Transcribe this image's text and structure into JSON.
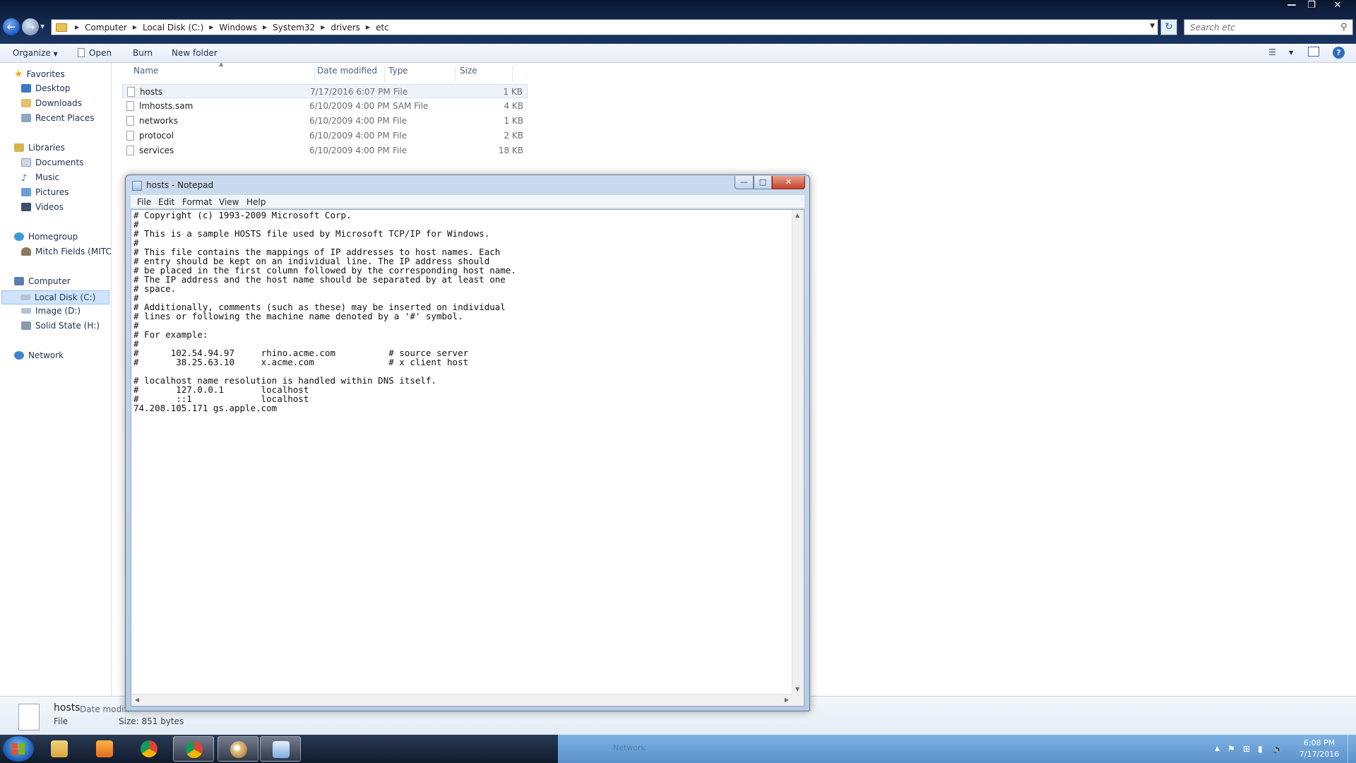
{
  "explorer": {
    "breadcrumb": [
      "Computer",
      "Local Disk (C:)",
      "Windows",
      "System32",
      "drivers",
      "etc"
    ],
    "search_placeholder": "Search etc",
    "toolbar": {
      "organize": "Organize",
      "open": "Open",
      "burn": "Burn",
      "new_folder": "New folder"
    },
    "nav": {
      "favorites": "Favorites",
      "desktop": "Desktop",
      "downloads": "Downloads",
      "recent_places": "Recent Places",
      "libraries": "Libraries",
      "documents": "Documents",
      "music": "Music",
      "pictures": "Pictures",
      "videos": "Videos",
      "homegroup": "Homegroup",
      "homegroup_user": "Mitch Fields (MITCH",
      "computer": "Computer",
      "local_disk": "Local Disk (C:)",
      "image_drive": "Image (D:)",
      "solid_state": "Solid State (H:)",
      "network": "Network"
    },
    "columns": {
      "name": "Name",
      "date_modified": "Date modified",
      "type": "Type",
      "size": "Size"
    },
    "files": [
      {
        "name": "hosts",
        "date": "7/17/2016 6:07 PM",
        "type": "File",
        "size": "1 KB"
      },
      {
        "name": "lmhosts.sam",
        "date": "6/10/2009 4:00 PM",
        "type": "SAM File",
        "size": "4 KB"
      },
      {
        "name": "networks",
        "date": "6/10/2009 4:00 PM",
        "type": "File",
        "size": "1 KB"
      },
      {
        "name": "protocol",
        "date": "6/10/2009 4:00 PM",
        "type": "File",
        "size": "2 KB"
      },
      {
        "name": "services",
        "date": "6/10/2009 4:00 PM",
        "type": "File",
        "size": "18 KB"
      }
    ],
    "details": {
      "name": "hosts",
      "date_modified_label": "Date modifi",
      "type": "File",
      "size": "Size: 851 bytes"
    }
  },
  "notepad": {
    "title": "hosts - Notepad",
    "menu": {
      "file": "File",
      "edit": "Edit",
      "format": "Format",
      "view": "View",
      "help": "Help"
    },
    "content": "# Copyright (c) 1993-2009 Microsoft Corp.\n#\n# This is a sample HOSTS file used by Microsoft TCP/IP for Windows.\n#\n# This file contains the mappings of IP addresses to host names. Each\n# entry should be kept on an individual line. The IP address should\n# be placed in the first column followed by the corresponding host name.\n# The IP address and the host name should be separated by at least one\n# space.\n#\n# Additionally, comments (such as these) may be inserted on individual\n# lines or following the machine name denoted by a '#' symbol.\n#\n# For example:\n#\n#      102.54.94.97     rhino.acme.com          # source server\n#       38.25.63.10     x.acme.com              # x client host\n\n# localhost name resolution is handled within DNS itself.\n#\t127.0.0.1       localhost\n#\t::1             localhost\n74.208.105.171 gs.apple.com"
  },
  "taskbar": {
    "network_ghost": "Network",
    "clock_time": "6:08 PM",
    "clock_date": "7/17/2016"
  },
  "icons": {
    "back": "back-arrow-icon",
    "forward": "forward-arrow-icon",
    "search": "magnifier-icon",
    "help": "question-icon"
  }
}
